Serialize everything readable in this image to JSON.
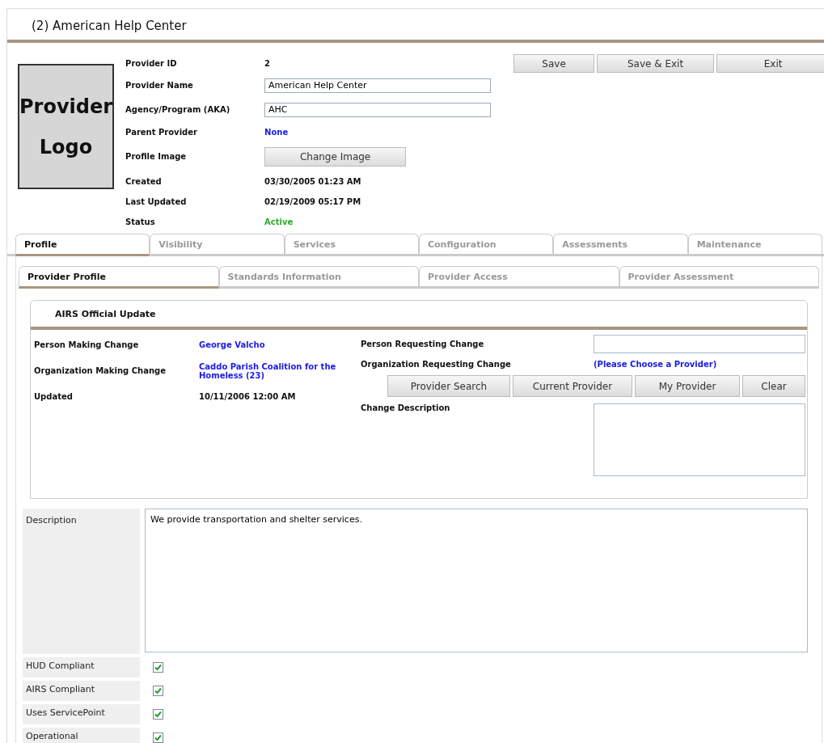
{
  "window": {
    "title": "(2) American Help Center"
  },
  "logo": {
    "text": "Provider Logo"
  },
  "header_fields": [
    {
      "label": "Provider ID",
      "kind": "text",
      "value": "2"
    },
    {
      "label": "Provider Name",
      "kind": "input",
      "value": "American Help Center"
    },
    {
      "label": "Agency/Program (AKA)",
      "kind": "input",
      "value": "AHC"
    },
    {
      "label": "Parent Provider",
      "kind": "link",
      "value": "None"
    },
    {
      "label": "Profile Image",
      "kind": "button",
      "value": "Change Image"
    },
    {
      "label": "Created",
      "kind": "text",
      "value": "03/30/2005 01:23 AM"
    },
    {
      "label": "Last Updated",
      "kind": "text",
      "value": "02/19/2009 05:17 PM"
    },
    {
      "label": "Status",
      "kind": "status",
      "value": "Active"
    }
  ],
  "actions": [
    "Save",
    "Save & Exit",
    "Exit"
  ],
  "tabs": [
    {
      "label": "Profile",
      "selected": true
    },
    {
      "label": "Visibility",
      "selected": false
    },
    {
      "label": "Services",
      "selected": false
    },
    {
      "label": "Configuration",
      "selected": false
    },
    {
      "label": "Assessments",
      "selected": false
    },
    {
      "label": "Maintenance",
      "selected": false
    }
  ],
  "subtabs": [
    {
      "label": "Provider Profile",
      "selected": true
    },
    {
      "label": "Standards Information",
      "selected": false
    },
    {
      "label": "Provider Access",
      "selected": false
    },
    {
      "label": "Provider Assessment",
      "selected": false
    }
  ],
  "airs_update": {
    "title": "AIRS Official Update",
    "person_making_change": {
      "label": "Person Making Change",
      "value": "George Valcho"
    },
    "organization_making_change": {
      "label": "Organization Making Change",
      "value": "Caddo Parish Coalition for the Homeless (23)"
    },
    "updated": {
      "label": "Updated",
      "value": "10/11/2006 12:00 AM"
    },
    "person_requesting_change": {
      "label": "Person Requesting Change"
    },
    "organization_requesting_change": {
      "label": "Organization Requesting Change",
      "value": "(Please Choose a Provider)"
    },
    "buttons": [
      "Provider Search",
      "Current Provider",
      "My Provider",
      "Clear"
    ],
    "change_description": {
      "label": "Change Description"
    }
  },
  "description": {
    "label": "Description",
    "value": "We provide transportation and shelter services."
  },
  "flags": [
    {
      "label": "HUD Compliant",
      "checked": true
    },
    {
      "label": "AIRS Compliant",
      "checked": true
    },
    {
      "label": "Uses ServicePoint",
      "checked": true
    },
    {
      "label": "Operational",
      "checked": true
    }
  ]
}
